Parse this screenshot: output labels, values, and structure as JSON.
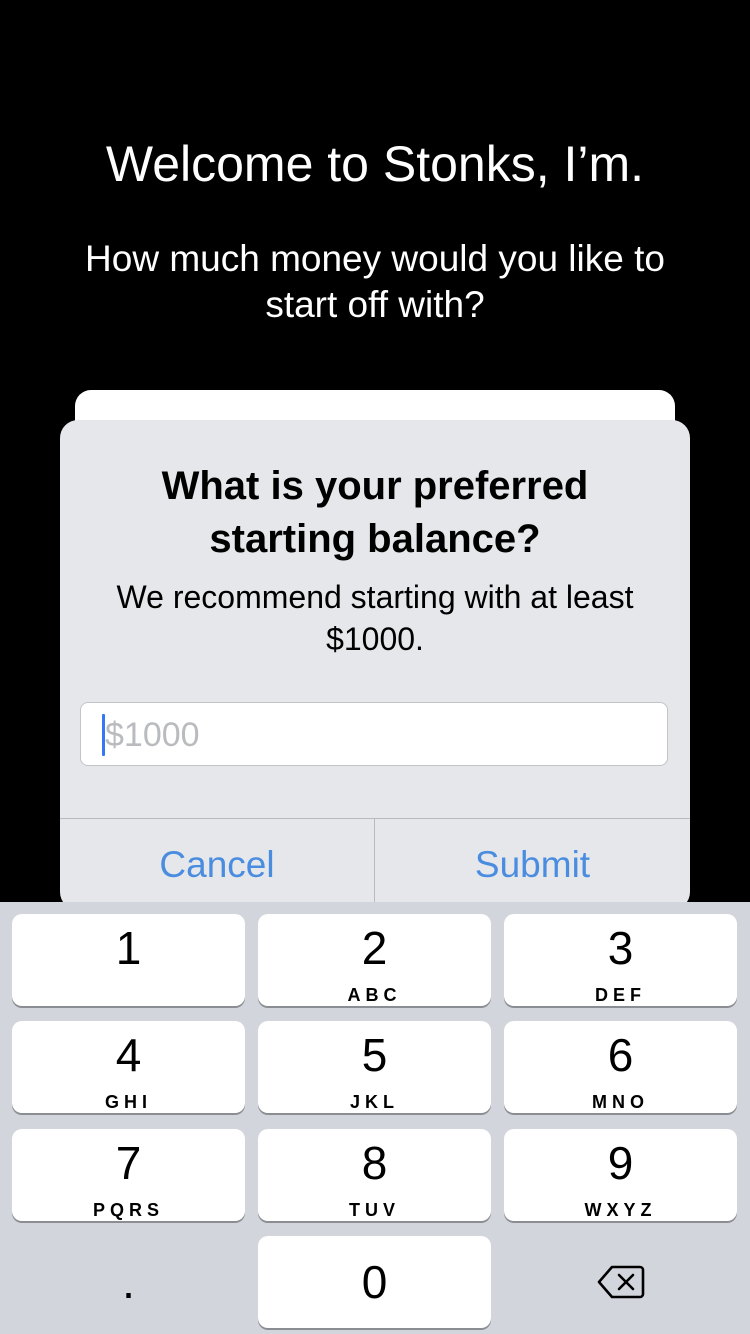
{
  "screen": {
    "welcome_title": "Welcome to Stonks, I’m.",
    "welcome_subtitle": "How much money would you like to start off with?"
  },
  "alert": {
    "title": "What is your preferred starting balance?",
    "message": "We recommend starting with at least $1000.",
    "input_placeholder": "$1000",
    "input_value": "",
    "cancel_label": "Cancel",
    "submit_label": "Submit"
  },
  "keyboard": {
    "keys": [
      {
        "digit": "1",
        "letters": ""
      },
      {
        "digit": "2",
        "letters": "ABC"
      },
      {
        "digit": "3",
        "letters": "DEF"
      },
      {
        "digit": "4",
        "letters": "GHI"
      },
      {
        "digit": "5",
        "letters": "JKL"
      },
      {
        "digit": "6",
        "letters": "MNO"
      },
      {
        "digit": "7",
        "letters": "PQRS"
      },
      {
        "digit": "8",
        "letters": "TUV"
      },
      {
        "digit": "9",
        "letters": "WXYZ"
      },
      {
        "digit": "0",
        "letters": ""
      }
    ],
    "dot_label": ".",
    "delete_icon": "backspace-icon"
  },
  "colors": {
    "background": "#000000",
    "alert_background": "#e5e7ea",
    "accent_button": "#4a8de0",
    "caret": "#3478f6",
    "keyboard_background": "#d2d5db"
  }
}
